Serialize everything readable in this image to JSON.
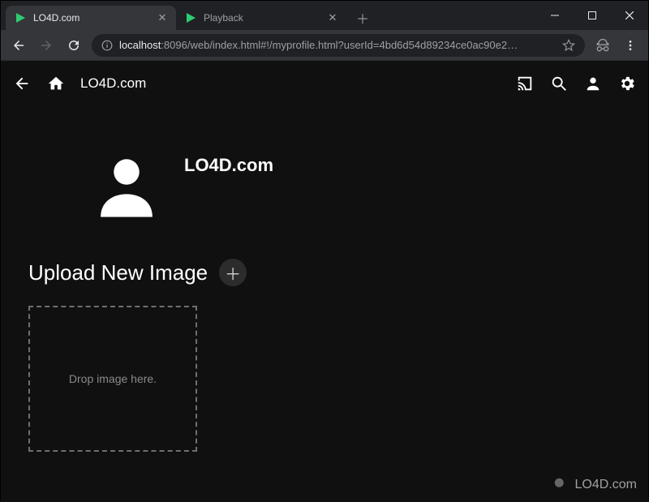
{
  "window": {
    "tabs": [
      {
        "label": "LO4D.com",
        "active": true
      },
      {
        "label": "Playback",
        "active": false
      }
    ]
  },
  "toolbar": {
    "url_host": "localhost",
    "url_port": ":8096",
    "url_path": "/web/index.html#!/myprofile.html?userId=4bd6d54d89234ce0ac90e2…"
  },
  "app": {
    "header_title": "LO4D.com",
    "profile_name": "LO4D.com",
    "upload_title": "Upload New Image",
    "dropzone_text": "Drop image here."
  },
  "watermark": {
    "text": "LO4D.com"
  }
}
